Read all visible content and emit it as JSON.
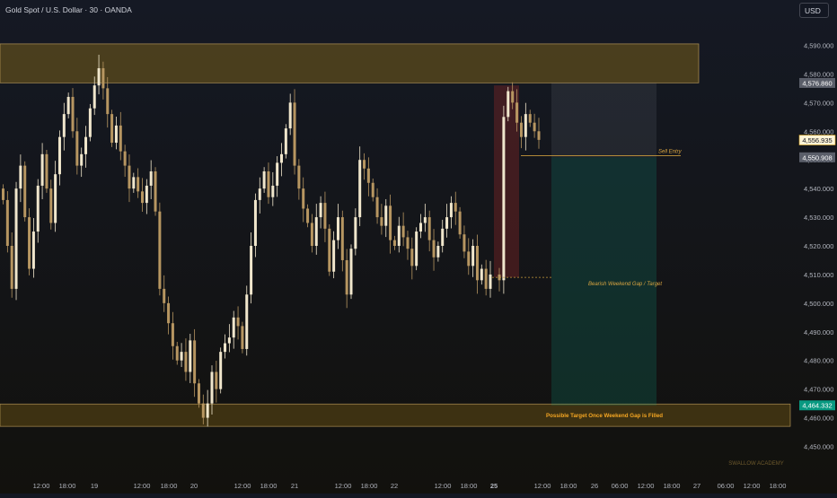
{
  "header": {
    "title": "Gold Spot / U.S. Dollar · 30 · OANDA",
    "currency": "USD"
  },
  "watermark": "SWALLOW ACADEMY",
  "colors": {
    "bg": "#131722",
    "up": "#f0e6cc",
    "down": "#b79661",
    "axis_text": "#b2b5be",
    "zone": "#d4a017",
    "target_label": "#f5a623"
  },
  "chart_data": {
    "type": "candlestick",
    "symbol": "XAUUSD",
    "interval": "30",
    "ylim": [
      4445,
      4600
    ],
    "y_ticks": [
      4450,
      4460,
      4470,
      4480,
      4490,
      4500,
      4510,
      4520,
      4530,
      4540,
      4550,
      4560,
      4570,
      4580,
      4590
    ],
    "x_ticks": [
      "12:00",
      "18:00",
      "19",
      "12:00",
      "18:00",
      "20",
      "12:00",
      "18:00",
      "21",
      "12:00",
      "18:00",
      "22",
      "12:00",
      "18:00",
      "25",
      "12:00",
      "18:00",
      "26",
      "06:00",
      "12:00",
      "18:00",
      "27",
      "06:00",
      "12:00",
      "18:00"
    ],
    "x_tick_bold": [
      false,
      false,
      false,
      false,
      false,
      false,
      false,
      false,
      false,
      false,
      false,
      false,
      false,
      false,
      true,
      false,
      false,
      false,
      false,
      false,
      false,
      false,
      false,
      false,
      false
    ],
    "series_close": [
      4536,
      4520,
      4505,
      4540,
      4548,
      4530,
      4512,
      4525,
      4541,
      4552,
      4540,
      4528,
      4545,
      4558,
      4566,
      4572,
      4560,
      4548,
      4552,
      4558,
      4568,
      4576,
      4582,
      4575,
      4566,
      4556,
      4562,
      4553,
      4548,
      4540,
      4544,
      4539,
      4535,
      4541,
      4546,
      4532,
      4505,
      4500,
      4493,
      4485,
      4480,
      4483,
      4476,
      4487,
      4472,
      4465,
      4460,
      4465,
      4476,
      4470,
      4483,
      4486,
      4488,
      4495,
      4492,
      4484,
      4503,
      4520,
      4536,
      4540,
      4546,
      4537,
      4541,
      4549,
      4552,
      4561,
      4570,
      4548,
      4540,
      4533,
      4528,
      4520,
      4530,
      4535,
      4526,
      4511,
      4522,
      4530,
      4515,
      4503,
      4519,
      4530,
      4550,
      4547,
      4542,
      4537,
      4530,
      4527,
      4534,
      4522,
      4520,
      4527,
      4523,
      4519,
      4513,
      4525,
      4528,
      4530,
      4522,
      4516,
      4520,
      4526,
      4530,
      4535,
      4532,
      4524,
      4518,
      4513,
      4520,
      4508,
      4512,
      4505,
      4510,
      4508,
      4565,
      4574,
      4570,
      4563,
      4558,
      4566,
      4563,
      4560,
      4557
    ],
    "price_labels": [
      {
        "text": "4,576.860",
        "value": 4576.86,
        "style": "grey"
      },
      {
        "text": "4,556.935",
        "value": 4556.94,
        "style": "current"
      },
      {
        "text": "4,550.908",
        "value": 4550.91,
        "style": "grey"
      },
      {
        "text": "4,464.332",
        "value": 4464.33,
        "style": "green"
      }
    ],
    "zones": [
      {
        "name": "resistance-zone",
        "y_top": 4590.5,
        "y_bottom": 4576.9
      },
      {
        "name": "support-zone",
        "y_top": 4464.8,
        "y_bottom": 4457.0,
        "label": "Possible Target Once Weekend Gap is Filled"
      }
    ],
    "annotations": [
      {
        "text": "Sell Entry",
        "value": 4551.5
      },
      {
        "text": "Bearish Weekend Gap / Target",
        "value": 4509.0
      }
    ],
    "gap_box": {
      "y_top": 4576.0,
      "y_bottom": 4509.0
    },
    "position": {
      "stop_top": 4576.9,
      "entry": 4550.9,
      "target": 4464.3
    }
  }
}
